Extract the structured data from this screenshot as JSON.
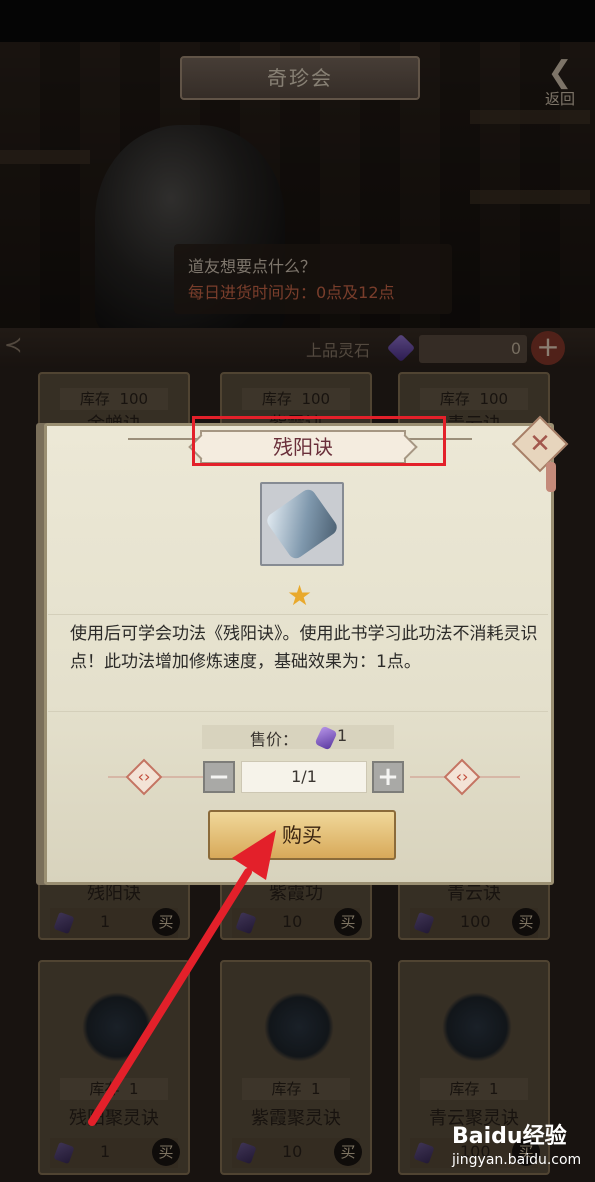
{
  "header": {
    "title": "奇珍会",
    "back_label": "返回"
  },
  "npc": {
    "line1": "道友想要点什么？",
    "line2": "每日进货时间为：0点及12点"
  },
  "currency": {
    "label": "上品灵石",
    "amount": "0",
    "add_label": "+"
  },
  "shop_items": [
    {
      "stock_label": "库存",
      "stock": "100",
      "name": "金蝉诀",
      "price": "1",
      "buy_label": "买"
    },
    {
      "stock_label": "库存",
      "stock": "100",
      "name": "紫霞诀",
      "price": "10",
      "buy_label": "买"
    },
    {
      "stock_label": "库存",
      "stock": "100",
      "name": "青云诀",
      "price": "100",
      "buy_label": "买"
    }
  ],
  "shop_items_row1_bottom": [
    {
      "name": "残阳诀",
      "price": "1",
      "buy_label": "买"
    },
    {
      "name": "紫霞功",
      "price": "10",
      "buy_label": "买"
    },
    {
      "name": "青云诀",
      "price": "100",
      "buy_label": "买"
    }
  ],
  "shop_items_row2": [
    {
      "stock_label": "库存",
      "stock": "1",
      "name": "残阳聚灵诀",
      "price": "1",
      "buy_label": "买"
    },
    {
      "stock_label": "库存",
      "stock": "1",
      "name": "紫霞聚灵诀",
      "price": "10",
      "buy_label": "买"
    },
    {
      "stock_label": "库存",
      "stock": "1",
      "name": "青云聚灵诀",
      "price": "100",
      "buy_label": "买"
    }
  ],
  "modal": {
    "title": "残阳诀",
    "close_label": "✕",
    "star": "★",
    "description": "使用后可学会功法《残阳诀》。使用此书学习此功法不消耗灵识点！此功法增加修炼速度，基础效果为：1点。",
    "price_label": "售价：",
    "price_value": "1",
    "quantity": "1/1",
    "minus_label": "−",
    "plus_label": "+",
    "buy_label": "购买"
  },
  "watermark": {
    "brand": "Baidu经验",
    "url": "jingyan.baidu.com"
  },
  "colors": {
    "highlight": "#e3202a",
    "arrow": "#e3202a",
    "title_text": "#6a2f3a",
    "buy_button": "#e8c77e"
  }
}
